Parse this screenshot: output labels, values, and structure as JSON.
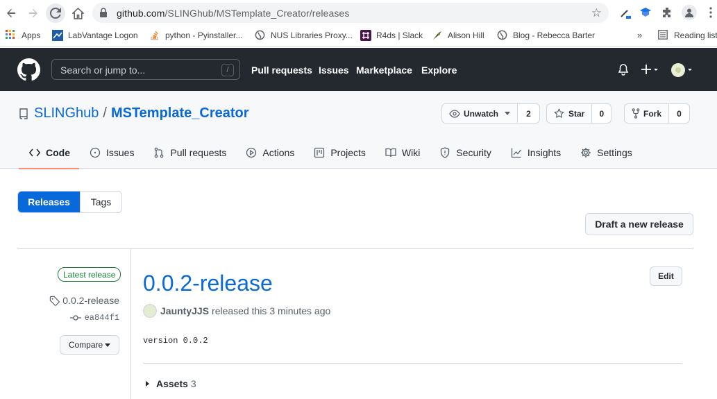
{
  "browser": {
    "url_host": "github.com",
    "url_path": "/SLINGhub/MSTemplate_Creator/releases",
    "bookmarks": [
      {
        "label": "Apps",
        "icon": "apps-grid-icon"
      },
      {
        "label": "LabVantage Logon",
        "icon": "labvantage-icon"
      },
      {
        "label": "python - Pyinstaller...",
        "icon": "stackoverflow-icon"
      },
      {
        "label": "NUS Libraries Proxy...",
        "icon": "globe-icon"
      },
      {
        "label": "R4ds | Slack",
        "icon": "slack-icon"
      },
      {
        "label": "Alison Hill",
        "icon": "alison-hill-icon"
      },
      {
        "label": "Blog - Rebecca Barter",
        "icon": "globe-icon"
      },
      {
        "label": "»",
        "icon": ""
      },
      {
        "label": "Reading list",
        "icon": "reading-list-icon"
      }
    ]
  },
  "header": {
    "search_placeholder": "Search or jump to...",
    "search_shortcut": "/",
    "nav": [
      "Pull requests",
      "Issues",
      "Marketplace",
      "Explore"
    ]
  },
  "repo": {
    "owner": "SLINGhub",
    "separator": "/",
    "name": "MSTemplate_Creator",
    "watch_label": "Unwatch",
    "watch_count": "2",
    "star_label": "Star",
    "star_count": "0",
    "fork_label": "Fork",
    "fork_count": "0",
    "tabs": [
      "Code",
      "Issues",
      "Pull requests",
      "Actions",
      "Projects",
      "Wiki",
      "Security",
      "Insights",
      "Settings"
    ]
  },
  "releases": {
    "subnav": [
      "Releases",
      "Tags"
    ],
    "draft_button": "Draft a new release",
    "latest_badge": "Latest release",
    "tag": "0.0.2-release",
    "commit": "ea844f1",
    "compare_label": "Compare",
    "title": "0.0.2-release",
    "edit_label": "Edit",
    "author": "JauntyJJS",
    "meta_text": "released this 3 minutes ago",
    "body": "version 0.0.2",
    "assets_label": "Assets",
    "assets_count": "3"
  }
}
